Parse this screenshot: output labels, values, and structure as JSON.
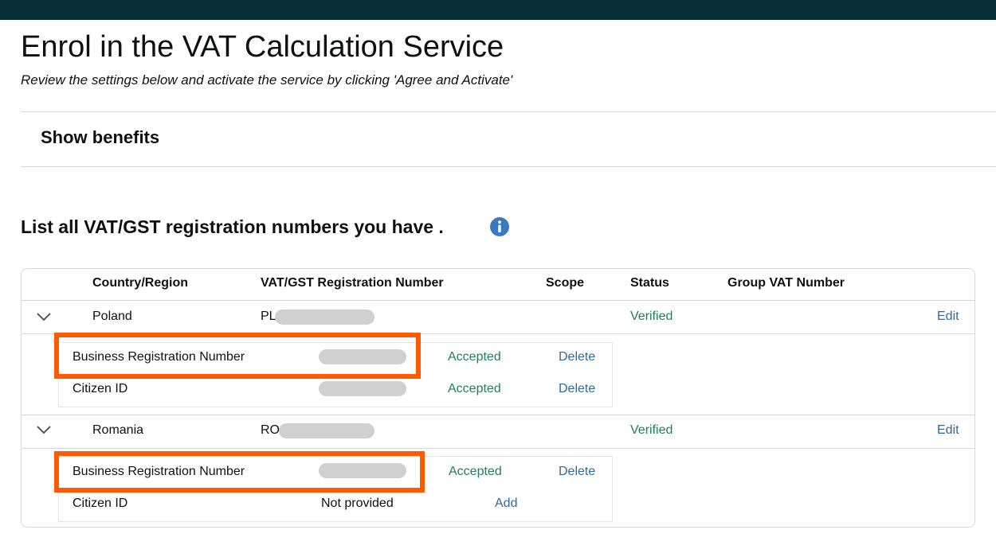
{
  "page": {
    "title": "Enrol in the VAT Calculation Service",
    "subtitle": "Review the settings below and activate the service by clicking 'Agree and Activate'"
  },
  "benefits": {
    "label": "Show benefits"
  },
  "registration": {
    "heading": "List all VAT/GST registration numbers you have .",
    "columns": [
      "Country/Region",
      "VAT/GST Registration Number",
      "Scope",
      "Status",
      "Group VAT Number"
    ],
    "countries": [
      {
        "name": "Poland",
        "vat_prefix": "PL",
        "status": "Verified",
        "edit": "Edit",
        "details": [
          {
            "label": "Business Registration Number",
            "status": "Accepted",
            "action": "Delete"
          },
          {
            "label": "Citizen ID",
            "status": "Accepted",
            "action": "Delete"
          }
        ]
      },
      {
        "name": "Romania",
        "vat_prefix": "RO",
        "status": "Verified",
        "edit": "Edit",
        "details": [
          {
            "label": "Business Registration Number",
            "status": "Accepted",
            "action": "Delete"
          },
          {
            "label": "Citizen ID",
            "value": "Not provided",
            "action": "Add"
          }
        ]
      }
    ]
  },
  "icons": {
    "info": "info-icon",
    "expand": "chevron-down-icon"
  },
  "colors": {
    "verified": "#237d60",
    "link": "#2e6b9e",
    "highlight": "#ff5a00",
    "topbar": "#0a2e36",
    "info": "#3b78c3"
  }
}
